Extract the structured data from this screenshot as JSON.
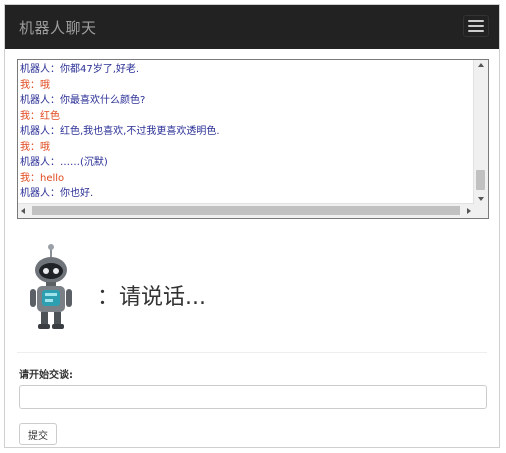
{
  "navbar": {
    "brand": "机器人聊天",
    "menu_icon": "hamburger-icon"
  },
  "chat_log": {
    "lines": [
      {
        "speaker": "robot",
        "prefix": "机器人：",
        "text": "你都47岁了,好老."
      },
      {
        "speaker": "me",
        "prefix": "我：",
        "text": "哦"
      },
      {
        "speaker": "robot",
        "prefix": "机器人：",
        "text": "你最喜欢什么颜色?"
      },
      {
        "speaker": "me",
        "prefix": "我：",
        "text": "红色"
      },
      {
        "speaker": "robot",
        "prefix": "机器人：",
        "text": "红色,我也喜欢,不过我更喜欢透明色."
      },
      {
        "speaker": "me",
        "prefix": "我：",
        "text": "哦"
      },
      {
        "speaker": "robot",
        "prefix": "机器人：",
        "text": "……(沉默)"
      },
      {
        "speaker": "me",
        "prefix": "我：",
        "text": "hello"
      },
      {
        "speaker": "robot",
        "prefix": "机器人：",
        "text": "你也好."
      }
    ],
    "colors": {
      "robot": "#2a2f96",
      "me": "#e0491e"
    }
  },
  "robot": {
    "icon": "robot-icon",
    "speech": "：请说话..."
  },
  "form": {
    "label": "请开始交谈:",
    "input_value": "",
    "input_placeholder": "",
    "submit_label": "提交"
  }
}
